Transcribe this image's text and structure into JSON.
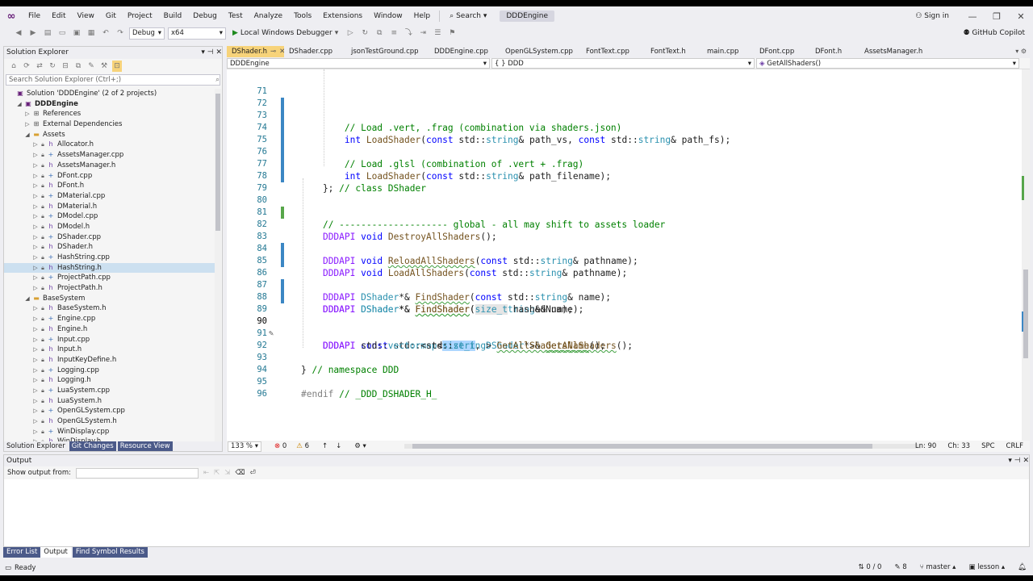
{
  "menubar": {
    "items": [
      "File",
      "Edit",
      "View",
      "Git",
      "Project",
      "Build",
      "Debug",
      "Test",
      "Analyze",
      "Tools",
      "Extensions",
      "Window",
      "Help"
    ],
    "search_label": "Search",
    "solution_name": "DDDEngine",
    "signin_label": "Sign in"
  },
  "toolbar": {
    "config": "Debug",
    "platform": "x64",
    "run_label": "Local Windows Debugger",
    "copilot_label": "GitHub Copilot"
  },
  "solution_explorer": {
    "title": "Solution Explorer",
    "search_placeholder": "Search Solution Explorer (Ctrl+;)",
    "items": [
      {
        "label": "Solution 'DDDEngine' (2 of 2 projects)",
        "icon": "solution-icon"
      },
      {
        "label": "DDDEngine",
        "icon": "project-icon"
      },
      {
        "label": "References",
        "icon": "references-icon"
      },
      {
        "label": "External Dependencies",
        "icon": "dependencies-icon"
      },
      {
        "label": "Assets",
        "icon": "folder-icon"
      },
      {
        "label": "Allocator.h",
        "icon": "header-icon"
      },
      {
        "label": "AssetsManager.cpp",
        "icon": "cpp-icon"
      },
      {
        "label": "AssetsManager.h",
        "icon": "header-icon"
      },
      {
        "label": "DFont.cpp",
        "icon": "cpp-icon"
      },
      {
        "label": "DFont.h",
        "icon": "header-icon"
      },
      {
        "label": "DMaterial.cpp",
        "icon": "cpp-icon"
      },
      {
        "label": "DMaterial.h",
        "icon": "header-icon"
      },
      {
        "label": "DModel.cpp",
        "icon": "cpp-icon"
      },
      {
        "label": "DModel.h",
        "icon": "header-icon"
      },
      {
        "label": "DShader.cpp",
        "icon": "cpp-icon"
      },
      {
        "label": "DShader.h",
        "icon": "header-icon"
      },
      {
        "label": "HashString.cpp",
        "icon": "cpp-icon"
      },
      {
        "label": "HashString.h",
        "icon": "header-icon"
      },
      {
        "label": "ProjectPath.cpp",
        "icon": "cpp-icon"
      },
      {
        "label": "ProjectPath.h",
        "icon": "header-icon"
      },
      {
        "label": "BaseSystem",
        "icon": "folder-icon"
      },
      {
        "label": "BaseSystem.h",
        "icon": "header-icon"
      },
      {
        "label": "Engine.cpp",
        "icon": "cpp-icon"
      },
      {
        "label": "Engine.h",
        "icon": "header-icon"
      },
      {
        "label": "Input.cpp",
        "icon": "cpp-icon"
      },
      {
        "label": "Input.h",
        "icon": "header-icon"
      },
      {
        "label": "InputKeyDefine.h",
        "icon": "header-icon"
      },
      {
        "label": "Logging.cpp",
        "icon": "cpp-icon"
      },
      {
        "label": "Logging.h",
        "icon": "header-icon"
      },
      {
        "label": "LuaSystem.cpp",
        "icon": "cpp-icon"
      },
      {
        "label": "LuaSystem.h",
        "icon": "header-icon"
      },
      {
        "label": "OpenGLSystem.cpp",
        "icon": "cpp-icon"
      },
      {
        "label": "OpenGLSystem.h",
        "icon": "header-icon"
      },
      {
        "label": "WinDisplay.cpp",
        "icon": "cpp-icon"
      },
      {
        "label": "WinDisplay.h",
        "icon": "header-icon"
      }
    ],
    "tabs": [
      "Solution Explorer",
      "Git Changes",
      "Resource View"
    ]
  },
  "editor": {
    "tabs": [
      "DShader.h",
      "DShader.cpp",
      "jsonTestGround.cpp",
      "DDDEngine.cpp",
      "OpenGLSystem.cpp",
      "FontText.cpp",
      "FontText.h",
      "main.cpp",
      "DFont.cpp",
      "DFont.h",
      "AssetsManager.h"
    ],
    "nav_project": "DDDEngine",
    "nav_scope": "{ } DDD",
    "nav_member": "GetAllShaders()",
    "line_numbers": [
      "71",
      "72",
      "73",
      "74",
      "75",
      "76",
      "77",
      "78",
      "79",
      "80",
      "81",
      "82",
      "83",
      "84",
      "85",
      "86",
      "87",
      "88",
      "89",
      "90",
      "91",
      "92",
      "93",
      "94",
      "95",
      "96"
    ],
    "comments": {
      "l72": "// Load .vert, .frag (combination via shaders.json)",
      "l75": "// Load .glsl (combination of .vert + .frag)",
      "l78": "// class DShader",
      "l81": "// -------------------- global - all may shift to assets loader",
      "l93": "// namespace DDD",
      "l95": "// _DDD_DSHADER_H_"
    },
    "zoom": "133 %",
    "errors": "0",
    "warnings": "6",
    "ln": "Ln: 90",
    "ch": "Ch: 33",
    "spc": "SPC",
    "eol": "CRLF"
  },
  "output": {
    "title": "Output",
    "show_from_label": "Show output from:"
  },
  "bottom_tabs": [
    "Error List",
    "Output",
    "Find Symbol Results"
  ],
  "statusbar": {
    "ready": "Ready",
    "changes": "0 / 0",
    "edits": "8",
    "branch": "master",
    "repo": "lesson"
  }
}
